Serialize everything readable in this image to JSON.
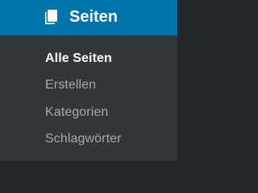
{
  "menu": {
    "header": {
      "label": "Seiten",
      "icon": "pages-icon",
      "background": "#0073aa"
    },
    "items": [
      {
        "label": "Alle Seiten",
        "current": true
      },
      {
        "label": "Erstellen",
        "current": false
      },
      {
        "label": "Kategorien",
        "current": false
      },
      {
        "label": "Schlagwörter",
        "current": false
      }
    ],
    "colors": {
      "submenu_background": "#32373c",
      "item_text": "#a4aaaf",
      "current_text": "#ffffff"
    }
  }
}
